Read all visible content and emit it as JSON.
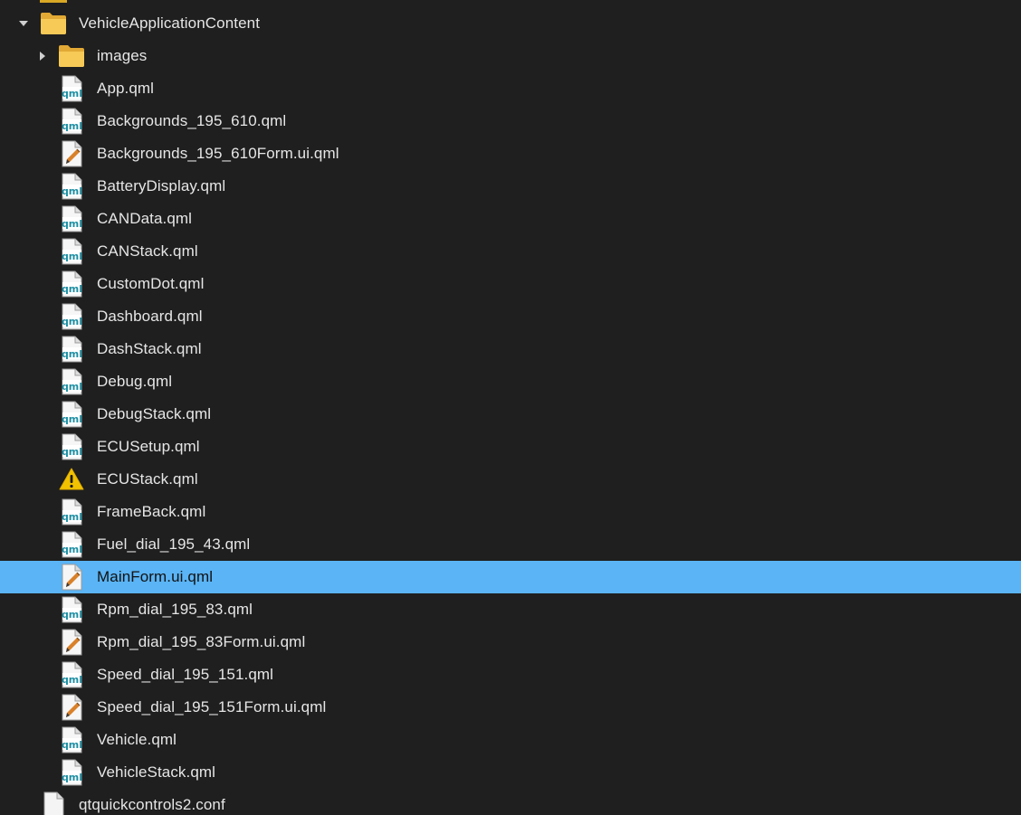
{
  "folder": {
    "name": "VehicleApplicationContent",
    "expanded": true
  },
  "subfolder": {
    "name": "images",
    "expanded": false
  },
  "files": [
    {
      "name": "App.qml",
      "icon": "qml-file-icon"
    },
    {
      "name": "Backgrounds_195_610.qml",
      "icon": "qml-file-icon"
    },
    {
      "name": "Backgrounds_195_610Form.ui.qml",
      "icon": "pencil-file-icon"
    },
    {
      "name": "BatteryDisplay.qml",
      "icon": "qml-file-icon"
    },
    {
      "name": "CANData.qml",
      "icon": "qml-file-icon"
    },
    {
      "name": "CANStack.qml",
      "icon": "qml-file-icon"
    },
    {
      "name": "CustomDot.qml",
      "icon": "qml-file-icon"
    },
    {
      "name": "Dashboard.qml",
      "icon": "qml-file-icon"
    },
    {
      "name": "DashStack.qml",
      "icon": "qml-file-icon"
    },
    {
      "name": "Debug.qml",
      "icon": "qml-file-icon"
    },
    {
      "name": "DebugStack.qml",
      "icon": "qml-file-icon"
    },
    {
      "name": "ECUSetup.qml",
      "icon": "qml-file-icon"
    },
    {
      "name": "ECUStack.qml",
      "icon": "warning-icon"
    },
    {
      "name": "FrameBack.qml",
      "icon": "qml-file-icon"
    },
    {
      "name": "Fuel_dial_195_43.qml",
      "icon": "qml-file-icon"
    },
    {
      "name": "MainForm.ui.qml",
      "icon": "pencil-file-icon",
      "selected": true
    },
    {
      "name": "Rpm_dial_195_83.qml",
      "icon": "qml-file-icon"
    },
    {
      "name": "Rpm_dial_195_83Form.ui.qml",
      "icon": "pencil-file-icon"
    },
    {
      "name": "Speed_dial_195_151.qml",
      "icon": "qml-file-icon"
    },
    {
      "name": "Speed_dial_195_151Form.ui.qml",
      "icon": "pencil-file-icon"
    },
    {
      "name": "Vehicle.qml",
      "icon": "qml-file-icon"
    },
    {
      "name": "VehicleStack.qml",
      "icon": "qml-file-icon"
    }
  ],
  "trailing_file": {
    "name": "qtquickcontrols2.conf",
    "icon": "blank-file-icon"
  },
  "colors": {
    "background": "#1f1f1f",
    "text": "#e6e6e6",
    "selection": "#5ab4f5",
    "folder": "#f5c451",
    "qml_teal": "#1e8fa3",
    "warning": "#f2c200",
    "pencil": "#d9812a"
  }
}
